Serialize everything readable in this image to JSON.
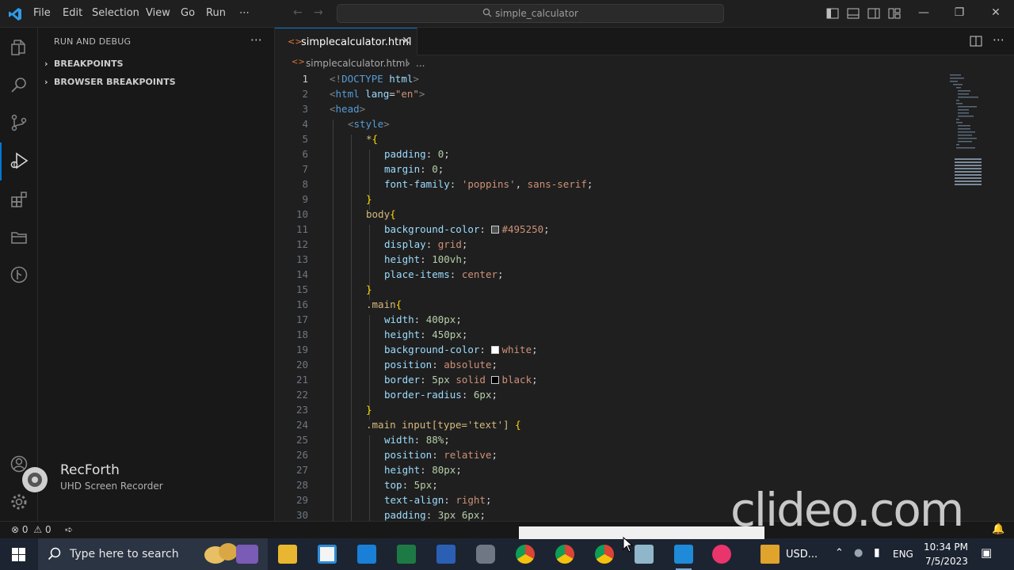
{
  "menu": [
    "File",
    "Edit",
    "Selection",
    "View",
    "Go",
    "Run",
    "⋯"
  ],
  "command_center": "simple_calculator",
  "sidebar": {
    "title": "RUN AND DEBUG",
    "more": "⋯",
    "sections": [
      {
        "label": "BREAKPOINTS"
      },
      {
        "label": "BROWSER BREAKPOINTS"
      }
    ]
  },
  "tab": {
    "label": "simplecalculator.html",
    "close": "✕"
  },
  "breadcrumb": {
    "file": "simplecalculator.html",
    "more": "..."
  },
  "editor": {
    "active_line": 1,
    "lines": [
      {
        "n": "1",
        "indent": 0,
        "tokens": [
          [
            "t-punc",
            "<!"
          ],
          [
            "t-tag",
            "DOCTYPE"
          ],
          [
            "",
            " "
          ],
          [
            "t-attr",
            "html"
          ],
          [
            "t-punc",
            ">"
          ]
        ]
      },
      {
        "n": "2",
        "indent": 0,
        "tokens": [
          [
            "t-punc",
            "<"
          ],
          [
            "t-tag",
            "html"
          ],
          [
            "",
            " "
          ],
          [
            "t-attr",
            "lang"
          ],
          [
            "",
            "="
          ],
          [
            "t-str",
            "\"en\""
          ],
          [
            "t-punc",
            ">"
          ]
        ]
      },
      {
        "n": "3",
        "indent": 0,
        "tokens": [
          [
            "t-punc",
            "<"
          ],
          [
            "t-tag",
            "head"
          ],
          [
            "t-punc",
            ">"
          ]
        ]
      },
      {
        "n": "4",
        "indent": 1,
        "tokens": [
          [
            "t-punc",
            "<"
          ],
          [
            "t-tag",
            "style"
          ],
          [
            "t-punc",
            ">"
          ]
        ]
      },
      {
        "n": "5",
        "indent": 2,
        "tokens": [
          [
            "t-sel",
            "*"
          ],
          [
            "t-brace",
            "{"
          ]
        ]
      },
      {
        "n": "6",
        "indent": 3,
        "tokens": [
          [
            "t-prop",
            "padding"
          ],
          [
            "",
            ": "
          ],
          [
            "t-num",
            "0"
          ],
          [
            "",
            ";"
          ]
        ]
      },
      {
        "n": "7",
        "indent": 3,
        "tokens": [
          [
            "t-prop",
            "margin"
          ],
          [
            "",
            ": "
          ],
          [
            "t-num",
            "0"
          ],
          [
            "",
            ";"
          ]
        ]
      },
      {
        "n": "8",
        "indent": 3,
        "tokens": [
          [
            "t-prop",
            "font-family"
          ],
          [
            "",
            ": "
          ],
          [
            "t-str",
            "'poppins'"
          ],
          [
            "",
            ", "
          ],
          [
            "t-val",
            "sans-serif"
          ],
          [
            "",
            ";"
          ]
        ]
      },
      {
        "n": "9",
        "indent": 2,
        "tokens": [
          [
            "t-brace",
            "}"
          ]
        ]
      },
      {
        "n": "10",
        "indent": 2,
        "tokens": [
          [
            "t-sel",
            "body"
          ],
          [
            "t-brace",
            "{"
          ]
        ]
      },
      {
        "n": "11",
        "indent": 3,
        "swatch": "#495250",
        "tokens": [
          [
            "t-prop",
            "background-color"
          ],
          [
            "",
            ": "
          ],
          [
            "swatch",
            ""
          ],
          [
            "t-val",
            "#495250"
          ],
          [
            "",
            ";"
          ]
        ]
      },
      {
        "n": "12",
        "indent": 3,
        "tokens": [
          [
            "t-prop",
            "display"
          ],
          [
            "",
            ": "
          ],
          [
            "t-val",
            "grid"
          ],
          [
            "",
            ";"
          ]
        ]
      },
      {
        "n": "13",
        "indent": 3,
        "tokens": [
          [
            "t-prop",
            "height"
          ],
          [
            "",
            ": "
          ],
          [
            "t-num",
            "100vh"
          ],
          [
            "",
            ";"
          ]
        ]
      },
      {
        "n": "14",
        "indent": 3,
        "tokens": [
          [
            "t-prop",
            "place-items"
          ],
          [
            "",
            ": "
          ],
          [
            "t-val",
            "center"
          ],
          [
            "",
            ";"
          ]
        ]
      },
      {
        "n": "15",
        "indent": 2,
        "tokens": [
          [
            "t-brace",
            "}"
          ]
        ]
      },
      {
        "n": "16",
        "indent": 2,
        "tokens": [
          [
            "t-sel",
            ".main"
          ],
          [
            "t-brace",
            "{"
          ]
        ]
      },
      {
        "n": "17",
        "indent": 3,
        "tokens": [
          [
            "t-prop",
            "width"
          ],
          [
            "",
            ": "
          ],
          [
            "t-num",
            "400px"
          ],
          [
            "",
            ";"
          ]
        ]
      },
      {
        "n": "18",
        "indent": 3,
        "tokens": [
          [
            "t-prop",
            "height"
          ],
          [
            "",
            ": "
          ],
          [
            "t-num",
            "450px"
          ],
          [
            "",
            ";"
          ]
        ]
      },
      {
        "n": "19",
        "indent": 3,
        "swatch": "#ffffff",
        "tokens": [
          [
            "t-prop",
            "background-color"
          ],
          [
            "",
            ": "
          ],
          [
            "swatch",
            ""
          ],
          [
            "t-val",
            "white"
          ],
          [
            "",
            ";"
          ]
        ]
      },
      {
        "n": "20",
        "indent": 3,
        "tokens": [
          [
            "t-prop",
            "position"
          ],
          [
            "",
            ": "
          ],
          [
            "t-val",
            "absolute"
          ],
          [
            "",
            ";"
          ]
        ]
      },
      {
        "n": "21",
        "indent": 3,
        "swatch": "#000000",
        "tokens": [
          [
            "t-prop",
            "border"
          ],
          [
            "",
            ": "
          ],
          [
            "t-num",
            "5px"
          ],
          [
            "",
            ""
          ],
          [
            "t-val",
            " solid "
          ],
          [
            "swatch",
            ""
          ],
          [
            "t-val",
            "black"
          ],
          [
            "",
            ";"
          ]
        ]
      },
      {
        "n": "22",
        "indent": 3,
        "tokens": [
          [
            "t-prop",
            "border-radius"
          ],
          [
            "",
            ": "
          ],
          [
            "t-num",
            "6px"
          ],
          [
            "",
            ";"
          ]
        ]
      },
      {
        "n": "23",
        "indent": 2,
        "tokens": [
          [
            "t-brace",
            "}"
          ]
        ]
      },
      {
        "n": "24",
        "indent": 2,
        "tokens": [
          [
            "t-sel",
            ".main input[type='text']"
          ],
          [
            "",
            " "
          ],
          [
            "t-brace",
            "{"
          ]
        ]
      },
      {
        "n": "25",
        "indent": 3,
        "tokens": [
          [
            "t-prop",
            "width"
          ],
          [
            "",
            ": "
          ],
          [
            "t-num",
            "88%"
          ],
          [
            "",
            ";"
          ]
        ]
      },
      {
        "n": "26",
        "indent": 3,
        "tokens": [
          [
            "t-prop",
            "position"
          ],
          [
            "",
            ": "
          ],
          [
            "t-val",
            "relative"
          ],
          [
            "",
            ";"
          ]
        ]
      },
      {
        "n": "27",
        "indent": 3,
        "tokens": [
          [
            "t-prop",
            "height"
          ],
          [
            "",
            ": "
          ],
          [
            "t-num",
            "80px"
          ],
          [
            "",
            ";"
          ]
        ]
      },
      {
        "n": "28",
        "indent": 3,
        "tokens": [
          [
            "t-prop",
            "top"
          ],
          [
            "",
            ": "
          ],
          [
            "t-num",
            "5px"
          ],
          [
            "",
            ";"
          ]
        ]
      },
      {
        "n": "29",
        "indent": 3,
        "tokens": [
          [
            "t-prop",
            "text-align"
          ],
          [
            "",
            ": "
          ],
          [
            "t-val",
            "right"
          ],
          [
            "",
            ";"
          ]
        ]
      },
      {
        "n": "30",
        "indent": 3,
        "tokens": [
          [
            "t-prop",
            "padding"
          ],
          [
            "",
            ": "
          ],
          [
            "t-num",
            "3px 6px"
          ],
          [
            "",
            ";"
          ]
        ]
      }
    ]
  },
  "status": {
    "errors": "0",
    "warnings": "0"
  },
  "taskbar": {
    "search_placeholder": "Type here to search",
    "currency": "USD...",
    "lang": "ENG",
    "time": "10:34 PM",
    "date": "7/5/2023"
  },
  "overlays": {
    "recorder_name": "RecForth",
    "recorder_sub": "UHD Screen Recorder",
    "watermark": "clideo.com"
  },
  "colors": {
    "accent": "#0078d4",
    "html_icon": "#e37933"
  }
}
